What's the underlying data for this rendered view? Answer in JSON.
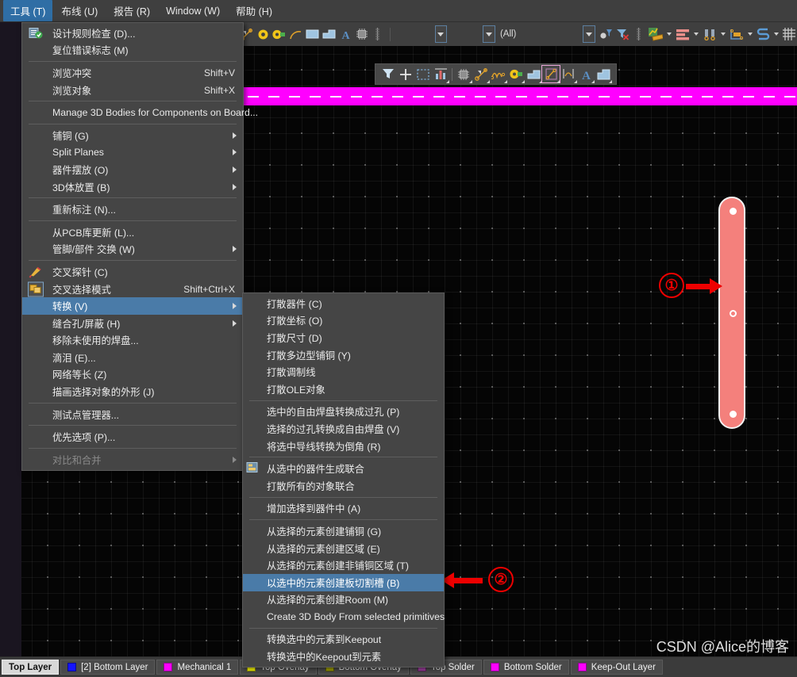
{
  "menubar": {
    "items": [
      {
        "label": "工具 (T)",
        "active": true,
        "name": "menubar-tools"
      },
      {
        "label": "布线 (U)",
        "active": false,
        "name": "menubar-route"
      },
      {
        "label": "报告 (R)",
        "active": false,
        "name": "menubar-reports"
      },
      {
        "label": "Window (W)",
        "active": false,
        "name": "menubar-window"
      },
      {
        "label": "帮助 (H)",
        "active": false,
        "name": "menubar-help"
      }
    ]
  },
  "toolbar": {
    "filter_label": "(All)",
    "icons": [
      "trace-icon",
      "via-icon",
      "pad-icon",
      "arc-icon",
      "fill-icon",
      "polygon-icon",
      "text-icon",
      "component-icon",
      "dimension-icon"
    ]
  },
  "float_toolbar": {
    "icons": [
      "filter-icon",
      "crosshair-icon",
      "select-region-icon",
      "measure-icon",
      "component-icon",
      "trace-icon",
      "route-icon",
      "pad-icon",
      "fill-icon",
      "polygon-cut-icon",
      "dimension-icon",
      "text-icon",
      "plane-icon"
    ]
  },
  "tools_menu": {
    "items": [
      {
        "type": "item",
        "label": "设计规则检查 (D)...",
        "shortcut": "",
        "icon": "drc-icon",
        "name": "menu-item-drc"
      },
      {
        "type": "item",
        "label": "复位错误标志 (M)",
        "shortcut": "",
        "icon": "",
        "name": "menu-item-reset-errors"
      },
      {
        "type": "sep"
      },
      {
        "type": "item",
        "label": "浏览冲突",
        "shortcut": "Shift+V",
        "icon": "",
        "name": "menu-item-browse-violations"
      },
      {
        "type": "item",
        "label": "浏览对象",
        "shortcut": "Shift+X",
        "icon": "",
        "name": "menu-item-browse-objects"
      },
      {
        "type": "sep"
      },
      {
        "type": "item",
        "label": "Manage 3D Bodies for Components on Board...",
        "shortcut": "",
        "icon": "",
        "name": "menu-item-manage-3d-bodies"
      },
      {
        "type": "sep"
      },
      {
        "type": "submenu",
        "label": "铺铜 (G)",
        "shortcut": "",
        "icon": "",
        "name": "menu-item-polygon-pours"
      },
      {
        "type": "submenu",
        "label": "Split Planes",
        "shortcut": "",
        "icon": "",
        "name": "menu-item-split-planes"
      },
      {
        "type": "submenu",
        "label": "器件摆放 (O)",
        "shortcut": "",
        "icon": "",
        "name": "menu-item-component-placement"
      },
      {
        "type": "submenu",
        "label": "3D体放置 (B)",
        "shortcut": "",
        "icon": "",
        "name": "menu-item-3d-body-placement"
      },
      {
        "type": "sep"
      },
      {
        "type": "item",
        "label": "重新标注 (N)...",
        "shortcut": "",
        "icon": "",
        "name": "menu-item-re-annotate"
      },
      {
        "type": "sep"
      },
      {
        "type": "item",
        "label": "从PCB库更新 (L)...",
        "shortcut": "",
        "icon": "",
        "name": "menu-item-update-from-pcb-lib"
      },
      {
        "type": "submenu",
        "label": "管脚/部件 交换 (W)",
        "shortcut": "",
        "icon": "",
        "name": "menu-item-pin-part-swap"
      },
      {
        "type": "sep"
      },
      {
        "type": "item",
        "label": "交叉探针 (C)",
        "shortcut": "",
        "icon": "cross-probe-icon",
        "name": "menu-item-cross-probe"
      },
      {
        "type": "item",
        "label": "交叉选择模式",
        "shortcut": "Shift+Ctrl+X",
        "icon": "cross-select-icon",
        "name": "menu-item-cross-select-mode"
      },
      {
        "type": "item",
        "label": "转换 (V)",
        "shortcut": "",
        "icon": "",
        "submenu": true,
        "highlighted": true,
        "name": "menu-item-convert"
      },
      {
        "type": "submenu",
        "label": "缝合孔/屏蔽 (H)",
        "shortcut": "",
        "icon": "",
        "name": "menu-item-stitching-shielding"
      },
      {
        "type": "item",
        "label": "移除未使用的焊盘...",
        "shortcut": "",
        "icon": "",
        "name": "menu-item-remove-unused-pads"
      },
      {
        "type": "item",
        "label": "滴泪 (E)...",
        "shortcut": "",
        "icon": "",
        "name": "menu-item-teardrops"
      },
      {
        "type": "item",
        "label": "网络等长 (Z)",
        "shortcut": "",
        "icon": "",
        "name": "menu-item-net-length"
      },
      {
        "type": "item",
        "label": "描画选择对象的外形 (J)",
        "shortcut": "",
        "icon": "",
        "name": "menu-item-outline-selected"
      },
      {
        "type": "sep"
      },
      {
        "type": "item",
        "label": "测试点管理器...",
        "shortcut": "",
        "icon": "",
        "name": "menu-item-testpoint-manager"
      },
      {
        "type": "sep"
      },
      {
        "type": "item",
        "label": "优先选项 (P)...",
        "shortcut": "",
        "icon": "",
        "name": "menu-item-preferences"
      },
      {
        "type": "sep"
      },
      {
        "type": "submenu-disabled",
        "label": "对比和合并",
        "shortcut": "",
        "icon": "",
        "name": "menu-item-compare-merge"
      }
    ]
  },
  "convert_menu": {
    "items": [
      {
        "type": "item",
        "label": "打散器件 (C)",
        "icon": "",
        "name": "menu-item-explode-component"
      },
      {
        "type": "item",
        "label": "打散坐标 (O)",
        "icon": "",
        "name": "menu-item-explode-coordinate"
      },
      {
        "type": "item",
        "label": "打散尺寸 (D)",
        "icon": "",
        "name": "menu-item-explode-dimension"
      },
      {
        "type": "item",
        "label": "打散多边型铺铜 (Y)",
        "icon": "",
        "name": "menu-item-explode-polygon"
      },
      {
        "type": "item",
        "label": "打散调制线",
        "icon": "",
        "name": "menu-item-explode-tuning-line"
      },
      {
        "type": "item",
        "label": "打散OLE对象",
        "icon": "",
        "name": "menu-item-explode-ole"
      },
      {
        "type": "sep"
      },
      {
        "type": "item",
        "label": "选中的自由焊盘转换成过孔 (P)",
        "icon": "",
        "name": "menu-item-pads-to-vias"
      },
      {
        "type": "item",
        "label": "选择的过孔转换成自由焊盘 (V)",
        "icon": "",
        "name": "menu-item-vias-to-pads"
      },
      {
        "type": "item",
        "label": "将选中导线转换为倒角 (R)",
        "icon": "",
        "name": "menu-item-tracks-to-chamfer"
      },
      {
        "type": "sep"
      },
      {
        "type": "item",
        "label": "从选中的器件生成联合",
        "icon": "union-icon",
        "name": "menu-item-create-union"
      },
      {
        "type": "item",
        "label": "打散所有的对象联合",
        "icon": "",
        "name": "menu-item-break-unions"
      },
      {
        "type": "sep"
      },
      {
        "type": "item",
        "label": "增加选择到器件中 (A)",
        "icon": "",
        "name": "menu-item-add-selection-to-component"
      },
      {
        "type": "sep"
      },
      {
        "type": "item",
        "label": "从选择的元素创建铺铜 (G)",
        "icon": "",
        "name": "menu-item-create-polygon-from-selected"
      },
      {
        "type": "item",
        "label": "从选择的元素创建区域 (E)",
        "icon": "",
        "name": "menu-item-create-region-from-selected"
      },
      {
        "type": "item",
        "label": "从选择的元素创建非铺铜区域 (T)",
        "icon": "",
        "name": "menu-item-create-cutout-from-selected"
      },
      {
        "type": "item",
        "label": "以选中的元素创建板切割槽 (B)",
        "icon": "",
        "highlighted": true,
        "name": "menu-item-create-board-cutout"
      },
      {
        "type": "item",
        "label": "从选择的元素创建Room (M)",
        "icon": "",
        "name": "menu-item-create-room-from-selected"
      },
      {
        "type": "item",
        "label": "Create 3D Body From selected primitives",
        "icon": "",
        "name": "menu-item-create-3d-body"
      },
      {
        "type": "sep"
      },
      {
        "type": "item",
        "label": "转换选中的元素到Keepout",
        "icon": "",
        "name": "menu-item-convert-to-keepout"
      },
      {
        "type": "item",
        "label": "转换选中的Keepout到元素",
        "icon": "",
        "name": "menu-item-convert-keepout-to-primitives"
      }
    ]
  },
  "annotations": [
    {
      "number": "①",
      "name": "annotation-1",
      "color": "#ee0000"
    },
    {
      "number": "②",
      "name": "annotation-2",
      "color": "#ee0000"
    }
  ],
  "board_object": {
    "name": "pcb-board-outline",
    "fill_color": "#f4807c",
    "outline_color": "#f2f2f2",
    "holes": 3
  },
  "layer_bar": {
    "tabs": [
      {
        "label": "Top Layer",
        "color": "",
        "active": true,
        "name": "layer-tab-top-layer"
      },
      {
        "label": "[2] Bottom Layer",
        "color": "#1414ff",
        "active": false,
        "name": "layer-tab-bottom-layer"
      },
      {
        "label": "Mechanical 1",
        "color": "#ff00ff",
        "active": false,
        "name": "layer-tab-mechanical-1"
      },
      {
        "label": "Top Overlay",
        "color": "#ffff00",
        "active": false,
        "name": "layer-tab-top-overlay"
      },
      {
        "label": "Bottom Overlay",
        "color": "#a0a000",
        "active": false,
        "name": "layer-tab-bottom-overlay"
      },
      {
        "label": "Top Solder",
        "color": "#a040a0",
        "active": false,
        "name": "layer-tab-top-solder"
      },
      {
        "label": "Bottom Solder",
        "color": "#ff00ff",
        "active": false,
        "name": "layer-tab-bottom-solder"
      },
      {
        "label": "Keep-Out Layer",
        "color": "#ff00ff",
        "active": false,
        "name": "layer-tab-keepout-layer"
      }
    ]
  },
  "watermark": {
    "text": "CSDN @Alice的博客"
  }
}
